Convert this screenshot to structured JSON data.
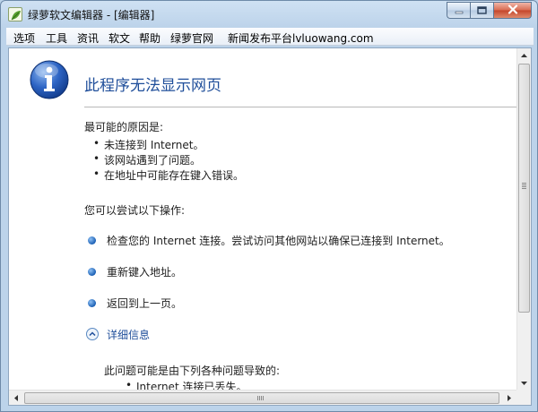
{
  "window": {
    "title": "绿萝软文编辑器 - [编辑器]",
    "app_icon": "leaf-icon",
    "controls": {
      "minimize_icon": "minimize-icon",
      "maximize_icon": "maximize-icon",
      "close_icon": "close-icon"
    }
  },
  "menu": {
    "items": [
      {
        "label": "选项"
      },
      {
        "label": "工具"
      },
      {
        "label": "资讯"
      },
      {
        "label": "软文"
      },
      {
        "label": "帮助"
      },
      {
        "label": "绿萝官网"
      },
      {
        "label": "新闻发布平台lvluowang.com"
      }
    ]
  },
  "error_page": {
    "icon": "info-icon",
    "title": "此程序无法显示网页",
    "causes_heading": "最可能的原因是:",
    "causes": [
      "未连接到 Internet。",
      "该网站遇到了问题。",
      "在地址中可能存在键入错误。"
    ],
    "actions_heading": "您可以尝试以下操作:",
    "actions": [
      "检查您的 Internet 连接。尝试访问其他网站以确保已连接到 Internet。",
      "重新键入地址。",
      "返回到上一页。"
    ],
    "details_label": "详细信息",
    "details_text": "此问题可能是由下列各种问题导致的:",
    "details_first_item": "Internet 连接已丢失。"
  },
  "colors": {
    "title_blue": "#1f4e9a",
    "window_frame": "#bcd3ea",
    "close_red": "#c4452a"
  }
}
